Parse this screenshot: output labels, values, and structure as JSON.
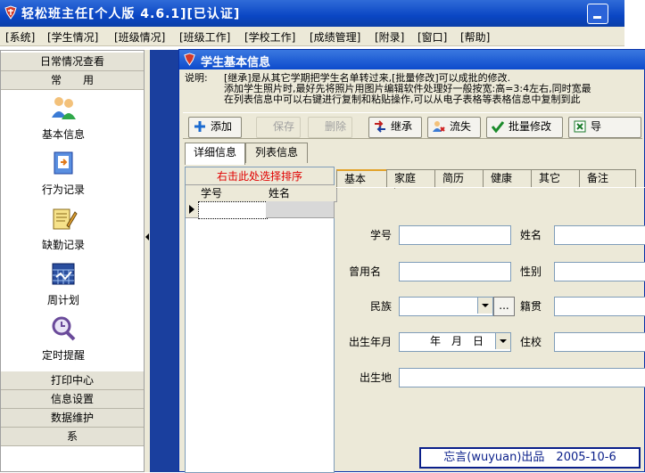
{
  "window": {
    "title": "轻松班主任[个人版 4.6.1][已认证]"
  },
  "menu": [
    {
      "label": "[系统]"
    },
    {
      "label": "[学生情况]"
    },
    {
      "label": "[班级情况]"
    },
    {
      "label": "[班级工作]"
    },
    {
      "label": "[学校工作]"
    },
    {
      "label": "[成绩管理]"
    },
    {
      "label": "[附录]"
    },
    {
      "label": "[窗口]"
    },
    {
      "label": "[帮助]"
    }
  ],
  "nav": {
    "group_daily": "日常情况查看",
    "group_common": "常　　用",
    "tools": [
      {
        "label": "基本信息",
        "icon": "people-icon"
      },
      {
        "label": "行为记录",
        "icon": "document-arrow-icon"
      },
      {
        "label": "缺勤记录",
        "icon": "notepad-pencil-icon"
      },
      {
        "label": "周计划",
        "icon": "calendar-grid-icon"
      },
      {
        "label": "定时提醒",
        "icon": "magnifier-icon"
      }
    ],
    "group_print": "打印中心",
    "group_info": "信息设置",
    "group_data": "数据维护",
    "group_sys": "系"
  },
  "child": {
    "title": "学生基本信息",
    "desc_label": "说明:",
    "desc_lines": [
      "[继承]是从其它学期把学生名单转过来,[批量修改]可以成批的修改.",
      "添加学生照片时,最好先将照片用图片编辑软件处理好一般按宽:高=3:4左右,同时宽最",
      "在列表信息中可以右键进行复制和粘贴操作,可以从电子表格等表格信息中复制到此"
    ],
    "toolbar": {
      "add": "添加",
      "save": "保存",
      "delete": "删除",
      "inherit": "继承",
      "lost": "流失",
      "batch": "批量修改",
      "export": "导"
    },
    "view_tabs": [
      "详细信息",
      "列表信息"
    ],
    "sort_hint": "右击此处选择排序",
    "grid_headers": [
      "学号",
      "姓名"
    ],
    "detail_tabs": [
      "基本",
      "家庭",
      "简历",
      "健康",
      "其它",
      "备注"
    ],
    "fields": {
      "student_id": "学号",
      "name": "姓名",
      "former_name": "曾用名",
      "gender": "性别",
      "ethnicity": "民族",
      "ellipsis": "...",
      "native_place": "籍贯",
      "birth": "出生年月",
      "birth_value": "年　月　日",
      "school": "住校",
      "birthplace": "出生地"
    }
  },
  "credit": "忘言(wuyuan)出品　2005-10-6",
  "colors": {
    "title_blue": "#0a46c4",
    "workspace_blue": "#1a3f9e",
    "sort_red": "#e00000",
    "credit_navy": "#0a1f8a"
  }
}
